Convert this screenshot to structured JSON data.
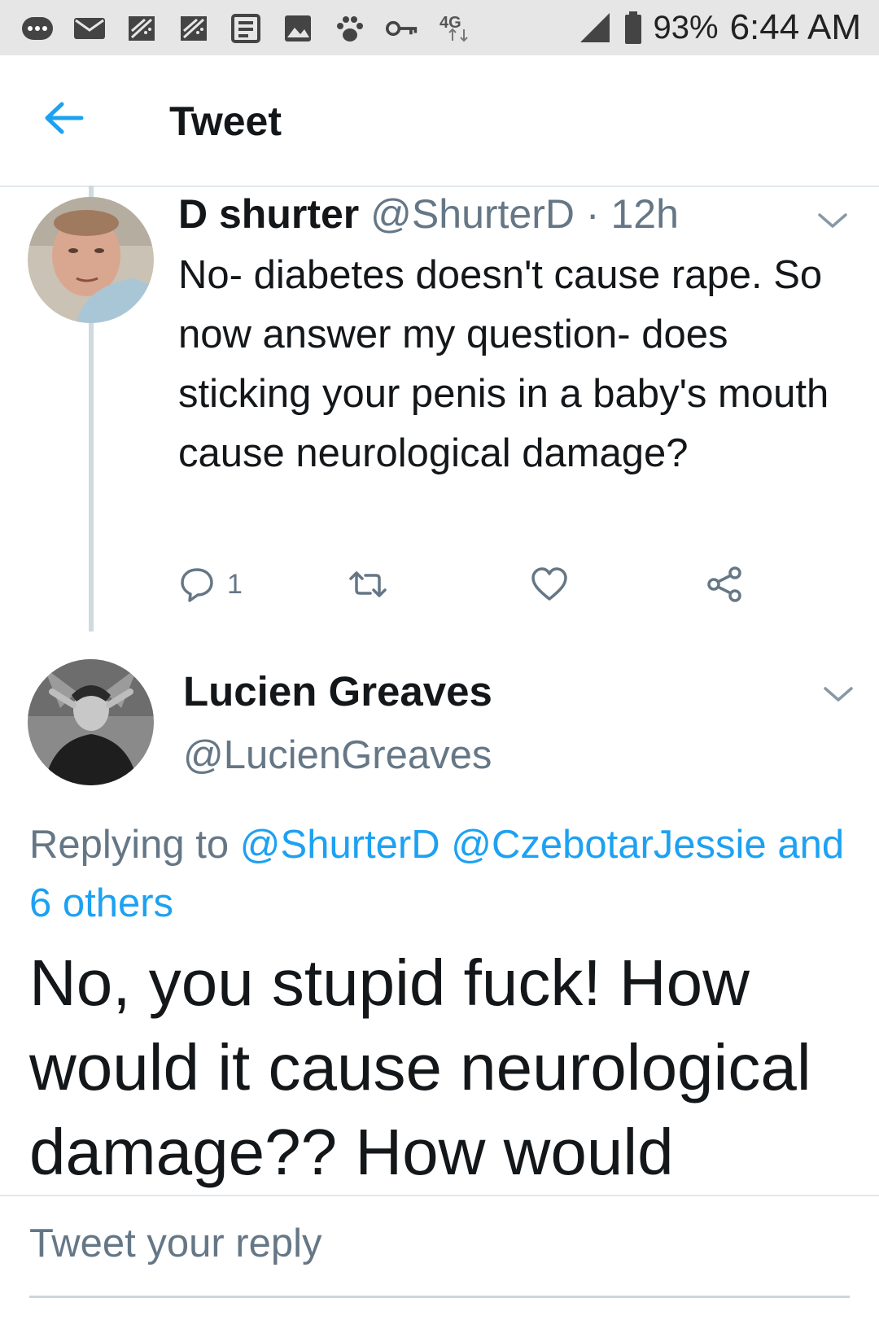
{
  "status_bar": {
    "battery": "93%",
    "time": "6:44 AM",
    "network": "4G",
    "icons": [
      "more-icon",
      "mail-icon",
      "bbm-icon",
      "bbm-icon",
      "news-icon",
      "gallery-icon",
      "paw-icon",
      "vpn-key-icon",
      "network-4g-icon",
      "signal-icon",
      "battery-icon"
    ]
  },
  "header": {
    "title": "Tweet"
  },
  "tweet1": {
    "name": "D shurter",
    "handle": "@ShurterD",
    "time": "· 12h",
    "text": "No- diabetes doesn't cause rape. So now answer my question- does sticking your penis in a baby's mouth cause neurological damage?",
    "reply_count": "1"
  },
  "tweet2": {
    "name": "Lucien Greaves",
    "handle": "@LucienGreaves",
    "replying_prefix": "Replying to",
    "replying_to_1": "@ShurterD",
    "replying_to_2": "@CzebotarJessie",
    "replying_others": "and 6 others",
    "text": "No, you stupid fuck! How would it cause neurological damage?? How would"
  },
  "reply_bar": {
    "placeholder": "Tweet your reply"
  },
  "colors": {
    "accent": "#1da1f2",
    "secondary_text": "#657786",
    "primary_text": "#14171a"
  }
}
